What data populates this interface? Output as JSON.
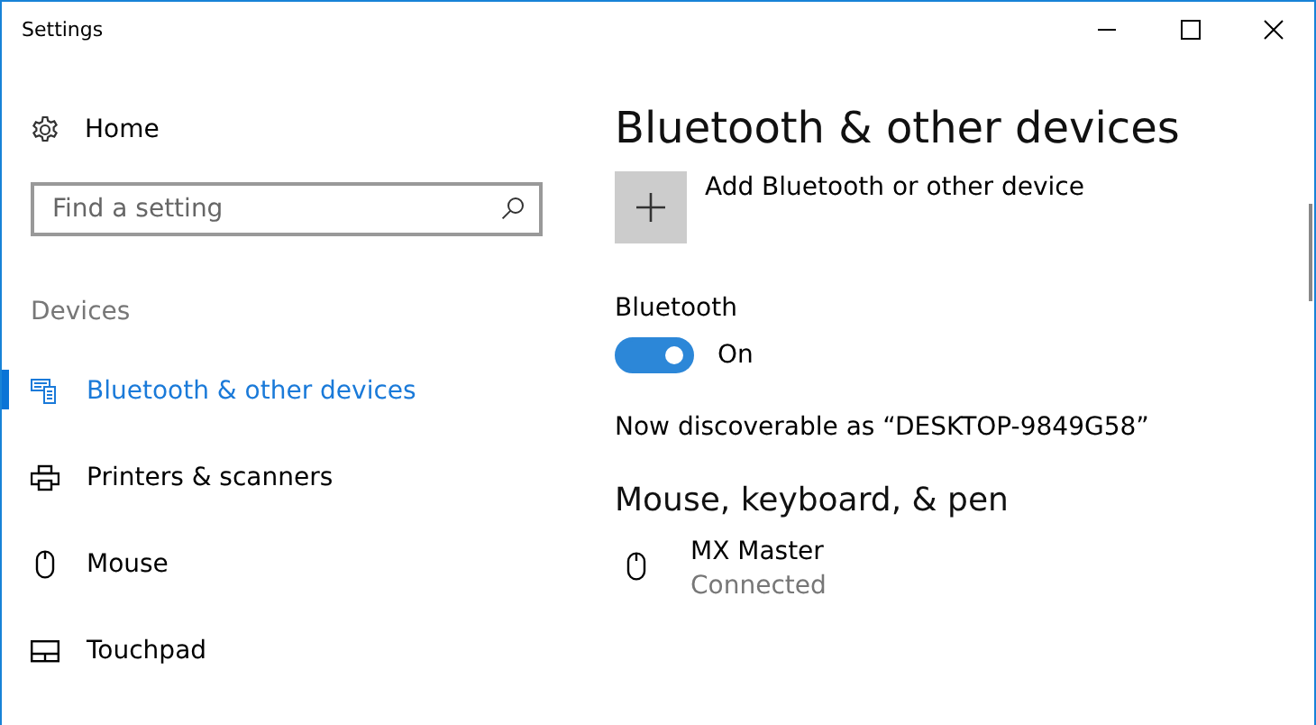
{
  "window": {
    "title": "Settings"
  },
  "sidebar": {
    "home": "Home",
    "search": {
      "placeholder": "Find a setting"
    },
    "section": "Devices",
    "items": [
      {
        "label": "Bluetooth & other devices",
        "kind": "bluetooth",
        "selected": true
      },
      {
        "label": "Printers & scanners",
        "kind": "printer",
        "selected": false
      },
      {
        "label": "Mouse",
        "kind": "mouse",
        "selected": false
      },
      {
        "label": "Touchpad",
        "kind": "touchpad",
        "selected": false
      }
    ]
  },
  "content": {
    "title": "Bluetooth & other devices",
    "add_button": "Add Bluetooth or other device",
    "bluetooth": {
      "label": "Bluetooth",
      "on": true,
      "state": "On"
    },
    "discoverable": "Now discoverable as “DESKTOP-9849G58”",
    "section": "Mouse, keyboard, & pen",
    "devices": [
      {
        "name": "MX Master",
        "status": "Connected",
        "kind": "mouse"
      }
    ]
  }
}
